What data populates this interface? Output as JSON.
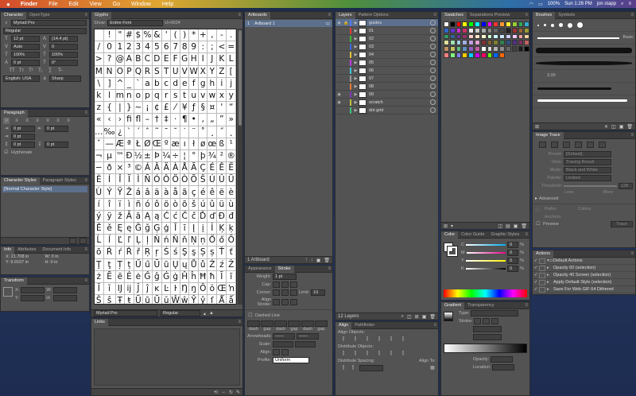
{
  "menubar": {
    "apple": "",
    "app": "Finder",
    "items": [
      "File",
      "Edit",
      "View",
      "Go",
      "Window",
      "Help"
    ],
    "battery": "100%",
    "clock": "Sun 1:26 PM",
    "user": "jon stapp"
  },
  "character": {
    "tabs": [
      "Character",
      "OpenType"
    ],
    "font": "Myriad Pro",
    "style": "Regular",
    "size": "12 pt",
    "leading": "(14.4 pt)",
    "kerning": "Auto",
    "tracking": "0",
    "hscale": "100%",
    "vscale": "100%",
    "baseline": "0 pt",
    "rotation": "0°",
    "language": "English: USA",
    "aa": "Sharp"
  },
  "paragraph": {
    "title": "Paragraph",
    "indent_left": "0 pt",
    "indent_first": "0 pt",
    "space_before": "0 pt",
    "indent_right": "0 pt",
    "space_after": "0 pt",
    "hyphenate": "Hyphenate"
  },
  "charstyles": {
    "tabs": [
      "Character Styles",
      "Paragraph Styles"
    ],
    "item": "[Normal Character Style]"
  },
  "info": {
    "tabs": [
      "Info",
      "Attributes",
      "Document Info"
    ],
    "x": "X: 21.708 in",
    "y": "Y: 9.9167 in",
    "w": "W: 0 in",
    "h": "H: 0 in"
  },
  "transform": {
    "title": "Transform",
    "labels": [
      "X:",
      "Y:",
      "W:",
      "H:"
    ]
  },
  "glyphs": {
    "title": "Glyphs",
    "show_label": "Show:",
    "show_value": "Entire Font",
    "code": "U+0024",
    "rows": [
      [
        " ",
        "!",
        "\"",
        "#",
        "$",
        "%",
        "&",
        "'",
        "(",
        ")",
        "*",
        "+",
        ",",
        "-",
        "."
      ],
      [
        "/",
        "0",
        "1",
        "2",
        "3",
        "4",
        "5",
        "6",
        "7",
        "8",
        "9",
        ":",
        ";",
        "<",
        "="
      ],
      [
        ">",
        "?",
        "@",
        "A",
        "B",
        "C",
        "D",
        "E",
        "F",
        "G",
        "H",
        "I",
        "J",
        "K",
        "L"
      ],
      [
        "M",
        "N",
        "O",
        "P",
        "Q",
        "R",
        "S",
        "T",
        "U",
        "V",
        "W",
        "X",
        "Y",
        "Z",
        "["
      ],
      [
        "\\",
        "]",
        "^",
        "_",
        "`",
        "a",
        "b",
        "c",
        "d",
        "e",
        "f",
        "g",
        "h",
        "i",
        "j"
      ],
      [
        "k",
        "l",
        "m",
        "n",
        "o",
        "p",
        "q",
        "r",
        "s",
        "t",
        "u",
        "v",
        "w",
        "x",
        "y"
      ],
      [
        "z",
        "{",
        "|",
        "}",
        "~",
        "¡",
        "¢",
        "£",
        "⁄",
        "¥",
        "ƒ",
        "§",
        "¤",
        "'",
        "“"
      ],
      [
        "«",
        "‹",
        "›",
        "ﬁ",
        "ﬂ",
        "–",
        "†",
        "‡",
        "·",
        "¶",
        "•",
        "‚",
        "„",
        "”",
        "»"
      ],
      [
        "…",
        "‰",
        "¿",
        "`",
        "´",
        "ˆ",
        "˜",
        "¯",
        "˘",
        "˙",
        "¨",
        "˚",
        "¸",
        "˝",
        "˛"
      ],
      [
        "ˇ",
        "—",
        "Æ",
        "ª",
        "Ł",
        "Ø",
        "Œ",
        "º",
        "æ",
        "ı",
        "ł",
        "ø",
        "œ",
        "ß",
        "¹"
      ],
      [
        "¬",
        "µ",
        "™",
        "Ð",
        "½",
        "±",
        "Þ",
        "¼",
        "÷",
        "¦",
        "°",
        "þ",
        "¾",
        "²",
        "®"
      ],
      [
        "−",
        "ð",
        "×",
        "³",
        "©",
        "Á",
        "Â",
        "Ä",
        "À",
        "Å",
        "Ã",
        "Ç",
        "É",
        "Ê",
        "Ë"
      ],
      [
        "È",
        "Í",
        "Î",
        "Ï",
        "Ì",
        "Ñ",
        "Ó",
        "Ô",
        "Ö",
        "Ò",
        "Õ",
        "Š",
        "Ú",
        "Û",
        "Ü"
      ],
      [
        "Ù",
        "Ý",
        "Ÿ",
        "Ž",
        "á",
        "â",
        "ä",
        "à",
        "å",
        "ã",
        "ç",
        "é",
        "ê",
        "ë",
        "è"
      ],
      [
        "í",
        "î",
        "ï",
        "ì",
        "ñ",
        "ó",
        "ô",
        "ö",
        "ò",
        "õ",
        "š",
        "ú",
        "û",
        "ü",
        "ù"
      ],
      [
        "ý",
        "ÿ",
        "ž",
        "Ă",
        "ă",
        "Ą",
        "ą",
        "Ć",
        "ć",
        "Č",
        "č",
        "Ď",
        "ď",
        "Đ",
        "đ"
      ],
      [
        "Ě",
        "ě",
        "Ę",
        "ę",
        "Ğ",
        "ğ",
        "Ģ",
        "ģ",
        "Ī",
        "ī",
        "Į",
        "į",
        "İ",
        "Ķ",
        "ķ"
      ],
      [
        "Ĺ",
        "ĺ",
        "Ľ",
        "ľ",
        "Ļ",
        "ļ",
        "Ń",
        "ń",
        "Ň",
        "ň",
        "Ņ",
        "ņ",
        "Ő",
        "ő",
        "Ō"
      ],
      [
        "ō",
        "Ŕ",
        "ŕ",
        "Ř",
        "ř",
        "Ŗ",
        "ŗ",
        "Ś",
        "ś",
        "Ş",
        "ş",
        "Ș",
        "ș",
        "Ť",
        "ť"
      ],
      [
        "Ţ",
        "ţ",
        "Ț",
        "ț",
        "Ű",
        "ű",
        "Ū",
        "ū",
        "Ų",
        "ų",
        "Ů",
        "ů",
        "Ź",
        "ź",
        "Ż"
      ],
      [
        "ż",
        "Ē",
        "ē",
        "Ė",
        "ė",
        "Ĝ",
        "ĝ",
        "Ġ",
        "ġ",
        "Ĥ",
        "ĥ",
        "Ħ",
        "ħ",
        "Ĩ",
        "ĩ"
      ],
      [
        "Ĭ",
        "ĭ",
        "Ĳ",
        "ĳ",
        "Ĵ",
        "ĵ",
        "ĸ",
        "Ŀ",
        "ŀ",
        "Ŋ",
        "ŋ",
        "Ŏ",
        "ŏ",
        "Œ",
        "ŉ"
      ],
      [
        "Ŝ",
        "ŝ",
        "Ŧ",
        "ŧ",
        "Ũ",
        "ũ",
        "Ŭ",
        "ŭ",
        "Ŵ",
        "ŵ",
        "Ŷ",
        "ŷ",
        "ſ",
        "Ǻ",
        "ǻ"
      ],
      [
        "Ǽ",
        "ǽ",
        "Ǿ",
        "ǿ",
        "Ά",
        "Έ",
        "Ή",
        "Ί",
        "Ό",
        "Ύ",
        "Ώ",
        "ΐ",
        "Α",
        "Β",
        "Γ"
      ]
    ],
    "font": "Myriad Pro",
    "style": "Regular"
  },
  "links": {
    "title": "Links"
  },
  "artboards": {
    "title": "Artboards",
    "item_num": "1",
    "item_name": "Artboard 1",
    "footer": "1 Artboard"
  },
  "stroke": {
    "tabs": [
      "Appearance",
      "Stroke"
    ],
    "weight_label": "Weight:",
    "weight": "1 pt",
    "cap": "Cap:",
    "corner": "Corner:",
    "limit_label": "Limit:",
    "limit": "10",
    "align": "Align Stroke:",
    "dashed": "Dashed Line",
    "dash_labels": [
      "dash",
      "gap",
      "dash",
      "gap",
      "dash",
      "gap"
    ],
    "arrowheads": "Arrowheads:",
    "scale": "Scale:",
    "align2": "Align:",
    "profile": "Profile:",
    "profile_value": "Uniform"
  },
  "layers": {
    "tabs": [
      "Layers",
      "Pattern Options"
    ],
    "items": [
      {
        "name": "guides",
        "color": "#4f7cff",
        "sel": true,
        "eye": "◉",
        "lock": "🔒"
      },
      {
        "name": "01",
        "color": "#e03c3c",
        "sel": false,
        "eye": "",
        "lock": ""
      },
      {
        "name": "02",
        "color": "#3cb83c",
        "sel": false,
        "eye": "",
        "lock": ""
      },
      {
        "name": "03",
        "color": "#3c6ae0",
        "sel": false,
        "eye": "",
        "lock": ""
      },
      {
        "name": "04",
        "color": "#e0c03c",
        "sel": false,
        "eye": "",
        "lock": ""
      },
      {
        "name": "05",
        "color": "#c03ce0",
        "sel": false,
        "eye": "",
        "lock": ""
      },
      {
        "name": "06",
        "color": "#3cc8d8",
        "sel": false,
        "eye": "",
        "lock": ""
      },
      {
        "name": "07",
        "color": "#9a9a9a",
        "sel": false,
        "eye": "",
        "lock": ""
      },
      {
        "name": "08",
        "color": "#e07c3c",
        "sel": false,
        "eye": "",
        "lock": ""
      },
      {
        "name": "09",
        "color": "#7c3cb8",
        "sel": false,
        "eye": "◉",
        "lock": ""
      },
      {
        "name": "scratch",
        "color": "#c0c040",
        "sel": false,
        "eye": "◉",
        "lock": ""
      },
      {
        "name": "dot grid",
        "color": "#40c07c",
        "sel": false,
        "eye": "",
        "lock": ""
      }
    ],
    "footer": "12 Layers"
  },
  "align": {
    "tabs": [
      "Align",
      "Pathfinder"
    ],
    "align_objects": "Align Objects:",
    "distribute_objects": "Distribute Objects:",
    "distribute_spacing": "Distribute Spacing:",
    "align_to": "Align To:"
  },
  "swatches": {
    "tabs": [
      "Swatches",
      "Separations Preview"
    ],
    "colors": [
      "#ffffff",
      "#000000",
      "#ff0000",
      "#ffff00",
      "#00ff00",
      "#00ffff",
      "#0000ff",
      "#ff00ff",
      "#ff3333",
      "#ff9933",
      "#ffee33",
      "#99cc33",
      "#33aa55",
      "#33aacc",
      "#3366cc",
      "#6633cc",
      "#cc33cc",
      "#cc3366",
      "#e8e8e8",
      "#cccccc",
      "#aaaaaa",
      "#888888",
      "#666666",
      "#444444",
      "#222222",
      "#993333",
      "#996633",
      "#999933",
      "#339966",
      "#336699",
      "#663399",
      "#993366",
      "#ffcccc",
      "#ffe5cc",
      "#ffffcc",
      "#ccffcc",
      "#ccffff",
      "#cce5ff",
      "#ccccff",
      "#ffccff",
      "#f2a0a0",
      "#f2d0a0",
      "#e0e0a0",
      "#a0e0b0",
      "#a0d0e0",
      "#a0b0e0",
      "#c0a0e0",
      "#e0a0d0",
      "#803030",
      "#806030",
      "#808030",
      "#308050",
      "#305080",
      "#503080",
      "#803060",
      "#c06060",
      "#c09060",
      "#c0c060",
      "#60c080",
      "#6090c0",
      "#9060c0",
      "#c060a0",
      "#ffffff",
      "#d9d9d9",
      "#b3b3b3",
      "#8c8c8c",
      "#666666",
      "#404040",
      "#1a1a1a",
      "#000000",
      "#ff8080",
      "#80ff80",
      "#8080ff",
      "#ffcc00",
      "#00ccff",
      "#cc00ff",
      "#ff0066",
      "#66ff00",
      "#0066ff",
      "#ff6600"
    ]
  },
  "brushes": {
    "tabs": [
      "Brushes",
      "Symbols"
    ],
    "basic": "Basic",
    "size": "3.00"
  },
  "imagetrace": {
    "title": "Image Trace",
    "preset": "Preset:",
    "preset_v": "[Default]",
    "view": "View:",
    "view_v": "Tracing Result",
    "mode": "Mode:",
    "mode_v": "Black and White",
    "palette": "Palette:",
    "palette_v": "Limited",
    "threshold": "Threshold:",
    "threshold_v": "128",
    "less": "Less",
    "more": "More",
    "advanced": "Advanced",
    "paths": "Paths:",
    "colors": "Colors:",
    "anchors": "Anchors:",
    "preview": "Preview",
    "trace": "Trace"
  },
  "color": {
    "tabs": [
      "Color",
      "Color Guide",
      "Graphic Styles"
    ],
    "c": "C",
    "m": "M",
    "y": "Y",
    "k": "K",
    "pct": "%",
    "c_v": "0",
    "m_v": "0",
    "y_v": "0",
    "k_v": "0"
  },
  "gradient": {
    "tabs": [
      "Gradient",
      "Transparency"
    ],
    "type": "Type:",
    "stroke": "Stroke:",
    "opacity": "Opacity:",
    "location": "Location:"
  },
  "actions": {
    "title": "Actions",
    "items": [
      "Default Actions",
      "Opacity 60 (selection)",
      "Opacity 40 Screen (selection)",
      "Apply Default Style (selection)",
      "Save For Web GIF 64 Dithered"
    ]
  }
}
